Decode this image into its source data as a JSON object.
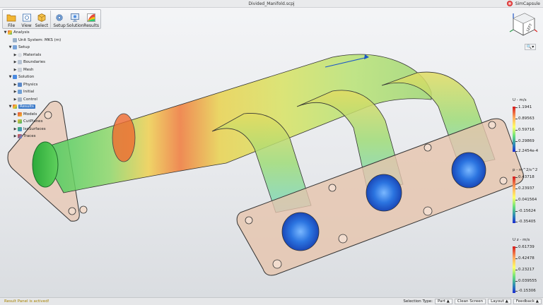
{
  "window": {
    "title": "Divided_Manifold.scpj",
    "app_name": "SimCapsule"
  },
  "toolbar": {
    "file": "File",
    "view": "View",
    "select": "Select",
    "setup": "Setup",
    "solution": "Solution",
    "results": "Results"
  },
  "tree": {
    "analysis": "Analysis",
    "unit_system": "Unit System: MKS (m)",
    "setup": "Setup",
    "materials": "Materials",
    "boundaries": "Boundaries",
    "mesh": "Mesh",
    "solution": "Solution",
    "physics": "Physics",
    "initial": "Initial",
    "control": "Control",
    "results": "Results",
    "models": "Models",
    "cutplanes": "CutPlanes",
    "isosurfaces": "IsoSurfaces",
    "traces": "Traces"
  },
  "legends": [
    {
      "title": "U - m/s",
      "ticks": [
        "1.1941",
        "0.89563",
        "0.59716",
        "0.29869",
        "2.2454e-4"
      ],
      "colors": [
        "#d7191c",
        "#fdae61",
        "#ffff66",
        "#66e07a",
        "#2b83ba",
        "#1a2bd0"
      ]
    },
    {
      "title": "p - m^2/s^2",
      "ticks": [
        "0.43718",
        "0.23937",
        "0.041564",
        "-0.15624",
        "-0.35405"
      ],
      "colors": [
        "#d7191c",
        "#fdae61",
        "#ffff66",
        "#66e07a",
        "#2b83ba",
        "#1a2bd0"
      ]
    },
    {
      "title": "U z - m/s",
      "ticks": [
        "0.61739",
        "0.42478",
        "0.23217",
        "0.039555",
        "-0.15306"
      ],
      "colors": [
        "#d7191c",
        "#fdae61",
        "#ffff66",
        "#66e07a",
        "#2b83ba",
        "#1a2bd0"
      ]
    }
  ],
  "viewcube": {
    "face_label": "LEFT"
  },
  "status": {
    "message": "Result Panel is actived!",
    "selection_type_label": "Selection Type:",
    "part": "Part",
    "clean_screen": "Clean Screen",
    "layout": "Layout",
    "feedback": "Feedback"
  }
}
